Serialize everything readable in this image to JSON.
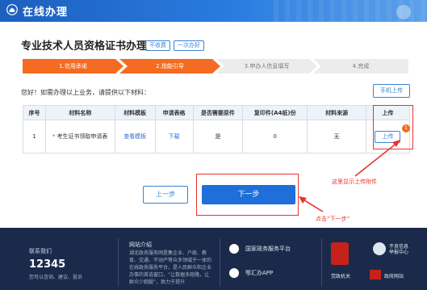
{
  "top_bar": {
    "title": "在线办理"
  },
  "page": {
    "title": "专业技术人员资格证书办理",
    "tags": [
      "不收费",
      "一次办好"
    ]
  },
  "steps": [
    {
      "label": "1.信用承诺",
      "state": "done"
    },
    {
      "label": "2.指能引导",
      "state": "active"
    },
    {
      "label": "3.申办人信息填写",
      "state": "todo"
    },
    {
      "label": "4.完成",
      "state": "todo"
    }
  ],
  "instruction": "您好！如需办理以上业务，请提供以下材料：",
  "mobile_upload_label": "手机上传",
  "table": {
    "headers": [
      "序号",
      "材料名称",
      "材料模板",
      "申请表格",
      "是否需要原件",
      "复印件(A4纸)份",
      "材料来源",
      "上传"
    ],
    "rows": [
      {
        "index": "1",
        "required_mark": "*",
        "name": "考生证书领取申请表",
        "template_link": "查看模板",
        "form_link": "下载",
        "original_needed": "是",
        "copies": "0",
        "source": "无",
        "upload_label": "上传",
        "upload_badge": "1"
      }
    ]
  },
  "annotations": {
    "upload_hint": "这里显示上传附件",
    "next_hint": "点击“下一步”"
  },
  "buttons": {
    "prev": "上一步",
    "next": "下一步"
  },
  "footer": {
    "contact_label": "联系我们",
    "phone": "12345",
    "contact_desc": "您可以咨询、建议、投诉",
    "intro_title": "网站介绍",
    "intro_text": "湖北政务服务网是集企业、户政、教育、交通、不动产等众多领域于一体的在线政务服务平台，是人民群众和企业办事的首选窗口，“让数据多跑路，让群众少跑腿”，致力于提升",
    "links": [
      "国家政务服务平台",
      "鄂汇办APP"
    ],
    "badge_label": "党政机关",
    "logo2_label": "不良信息举报中心",
    "logo3_label": "政府网站"
  },
  "colors": {
    "primary_blue": "#1e6fd9",
    "step_orange": "#f36c21",
    "annotation_red": "#e8352b",
    "footer_bg": "#1b2a4a"
  },
  "icons": {
    "home": "home-icon",
    "upload_badge": "badge-dot"
  }
}
